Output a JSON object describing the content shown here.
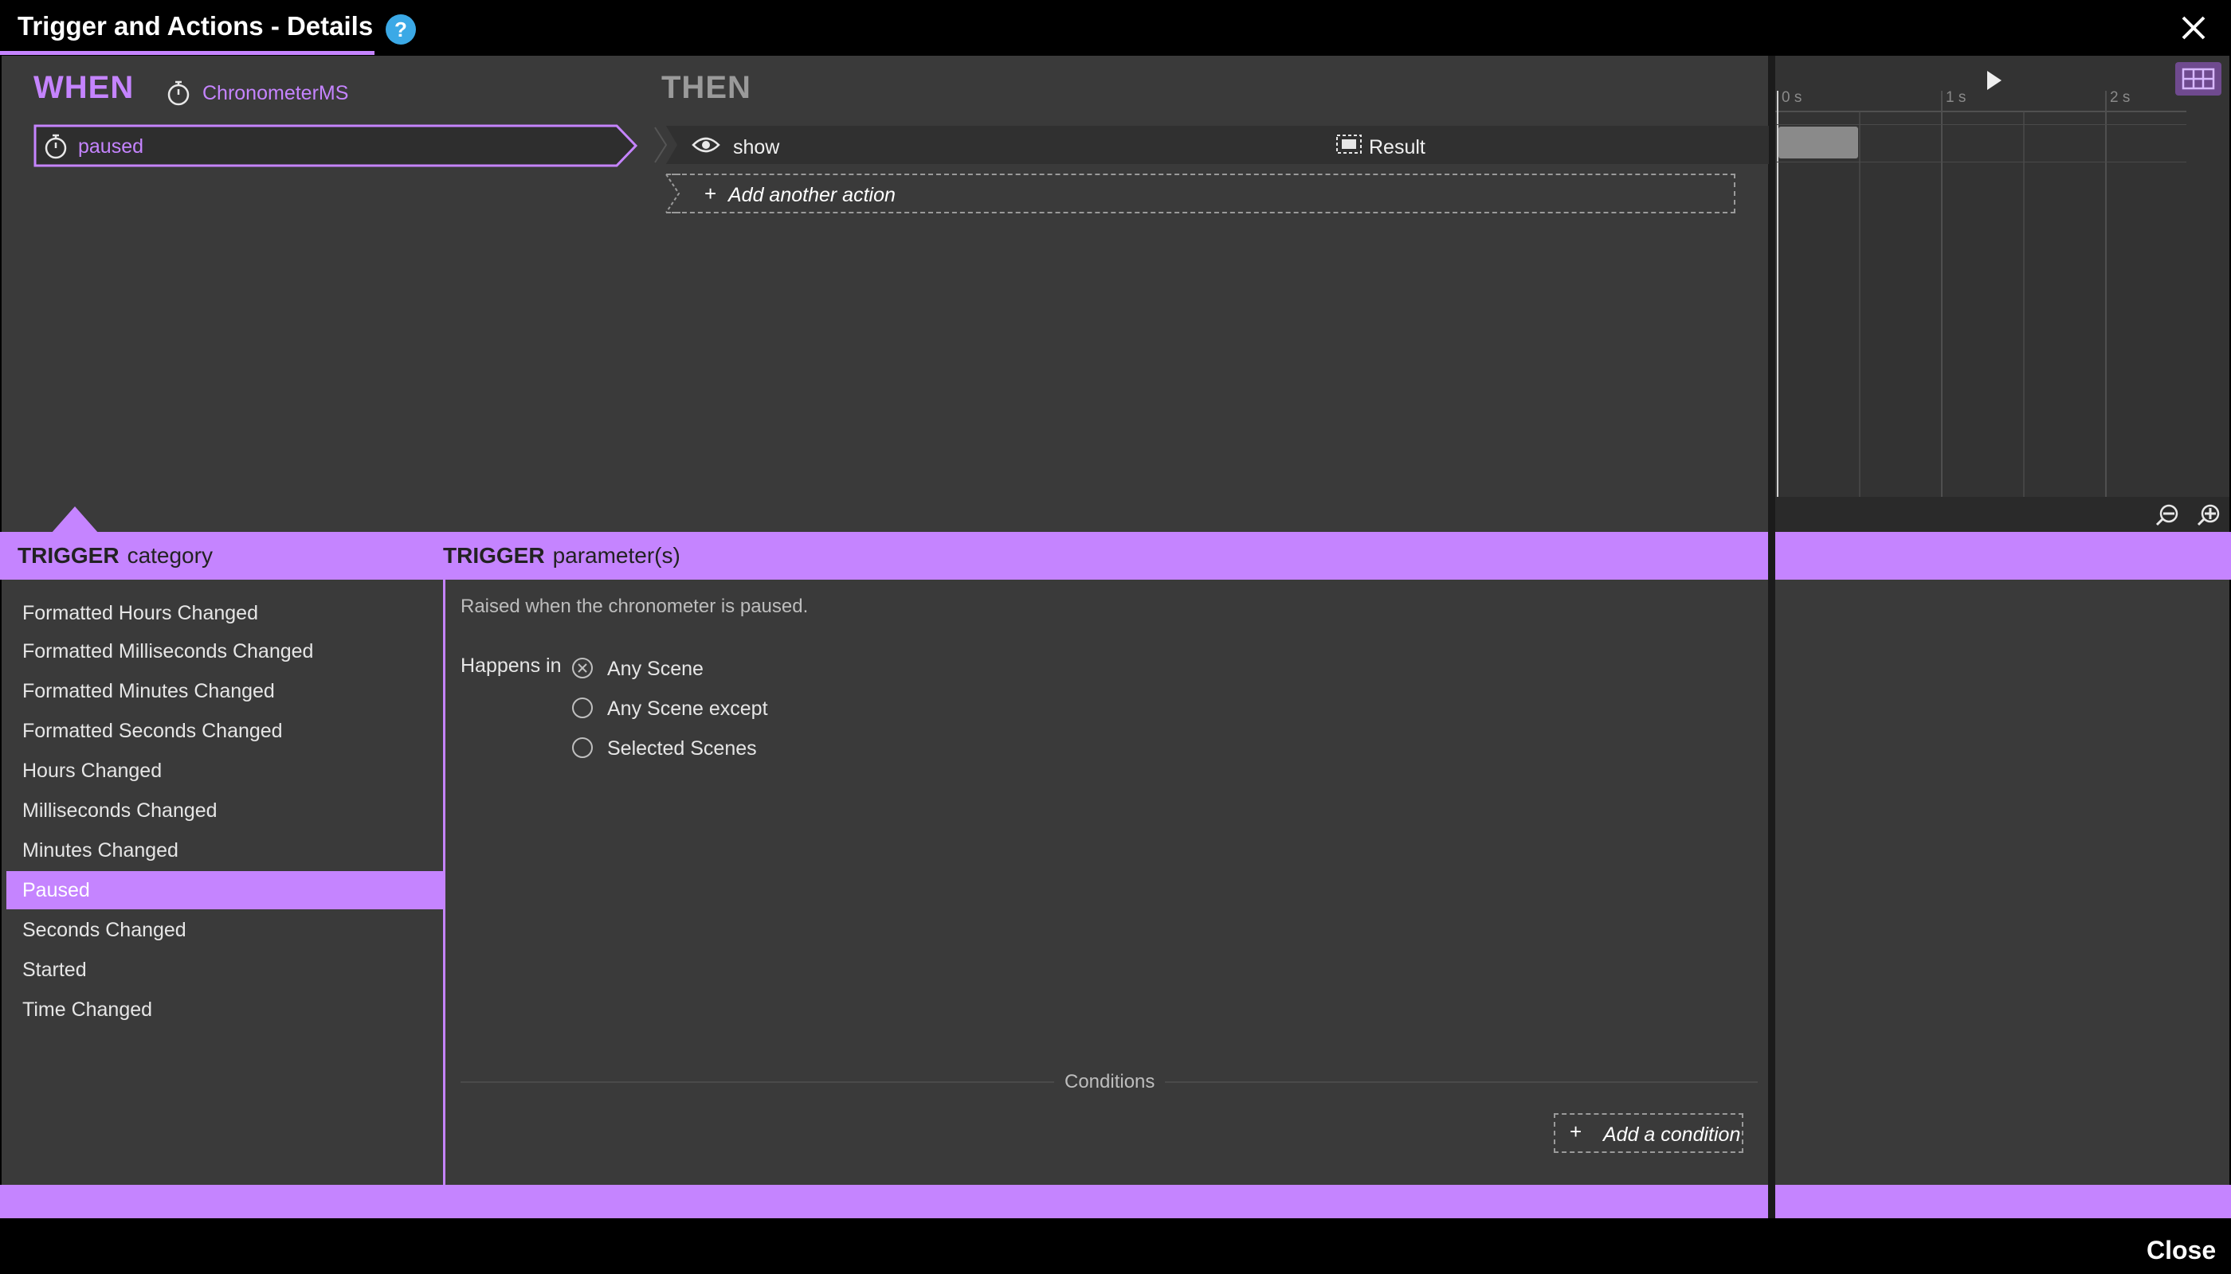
{
  "window": {
    "title": "Trigger and Actions - Details",
    "help_glyph": "?",
    "close_label": "Close"
  },
  "when": {
    "label": "WHEN",
    "object_name": "ChronometerMS",
    "object_icon": "stopwatch-icon",
    "trigger": "paused"
  },
  "then": {
    "label": "THEN",
    "actions": [
      {
        "verb": "show",
        "verb_icon": "eye-icon",
        "target": "Result",
        "target_icon": "panel-icon"
      }
    ],
    "add_action": "Add another action"
  },
  "timeline": {
    "ticks": [
      "0 s",
      "1 s",
      "2 s"
    ]
  },
  "trigger_category": {
    "header_bold": "TRIGGER",
    "header_rest": "category",
    "items": [
      "Formatted Hours Changed",
      "Formatted Milliseconds Changed",
      "Formatted Minutes Changed",
      "Formatted Seconds Changed",
      "Hours Changed",
      "Milliseconds Changed",
      "Minutes Changed",
      "Paused",
      "Seconds Changed",
      "Started",
      "Time Changed"
    ],
    "selected": "Paused"
  },
  "trigger_params": {
    "header_bold": "TRIGGER",
    "header_rest": "parameter(s)",
    "description": "Raised when the chronometer is paused.",
    "happens_in_label": "Happens in",
    "options": [
      "Any Scene",
      "Any Scene except",
      "Selected Scenes"
    ],
    "selected_option": "Any Scene",
    "conditions_label": "Conditions",
    "add_condition": "Add a condition"
  },
  "colors": {
    "accent": "#c584ff",
    "help": "#3ba9e6",
    "panel": "#3a3a3a"
  }
}
